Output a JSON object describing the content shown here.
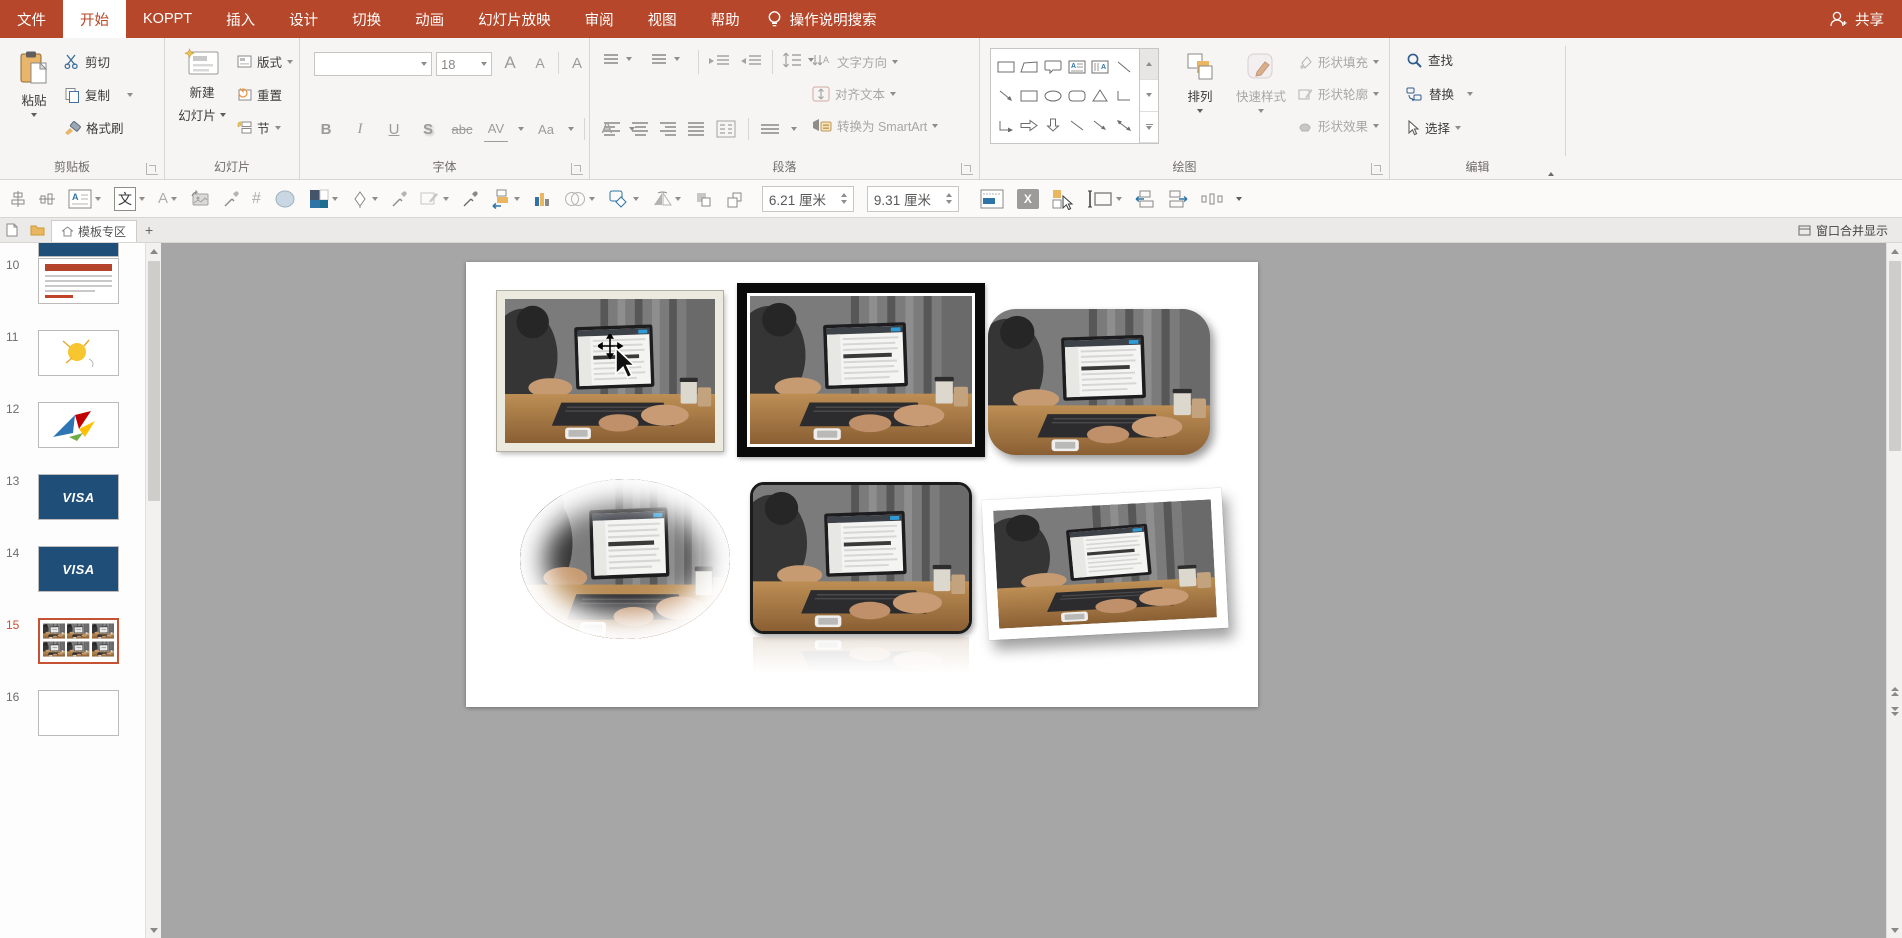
{
  "menubar": {
    "tabs": [
      {
        "label": "文件"
      },
      {
        "label": "开始"
      },
      {
        "label": "KOPPT"
      },
      {
        "label": "插入"
      },
      {
        "label": "设计"
      },
      {
        "label": "切换"
      },
      {
        "label": "动画"
      },
      {
        "label": "幻灯片放映"
      },
      {
        "label": "审阅"
      },
      {
        "label": "视图"
      },
      {
        "label": "帮助"
      }
    ],
    "search_label": "操作说明搜索",
    "share_label": "共享"
  },
  "ribbon": {
    "clipboard": {
      "group_label": "剪贴板",
      "paste": "粘贴",
      "cut": "剪切",
      "copy": "复制",
      "format_painter": "格式刷"
    },
    "slides": {
      "group_label": "幻灯片",
      "new_slide_line1": "新建",
      "new_slide_line2": "幻灯片",
      "layout": "版式",
      "reset": "重置",
      "section": "节"
    },
    "font": {
      "group_label": "字体",
      "font_size": "18",
      "bold": "B",
      "italic": "I",
      "underline": "U",
      "shadow": "S",
      "strikethrough": "abc",
      "char_spacing": "AV",
      "change_case": "Aa",
      "font_color": "A",
      "grow_font": "A",
      "shrink_font": "A",
      "clear_format": "A"
    },
    "paragraph": {
      "group_label": "段落",
      "text_direction": "文字方向",
      "align_text": "对齐文本",
      "smartart": "转换为 SmartArt"
    },
    "drawing": {
      "group_label": "绘图",
      "arrange": "排列",
      "quick_styles": "快速样式",
      "shape_fill": "形状填充",
      "shape_outline": "形状轮廓",
      "shape_effects": "形状效果"
    },
    "editing": {
      "group_label": "编辑",
      "find": "查找",
      "replace": "替换",
      "select": "选择"
    }
  },
  "drawing_toolbar": {
    "shape_width": "6.21 厘米",
    "shape_height": "9.31 厘米",
    "vertical_text_icon": "文",
    "wordart_icon": "A",
    "hash_icon": "#",
    "delete_icon": "X"
  },
  "tab_bar": {
    "template_tab": "模板专区",
    "add_tab": "+",
    "window_merge": "窗口合并显示"
  },
  "slide_panel": {
    "slides": [
      {
        "num": "10"
      },
      {
        "num": "11"
      },
      {
        "num": "12"
      },
      {
        "num": "13"
      },
      {
        "num": "14"
      },
      {
        "num": "15"
      },
      {
        "num": "16"
      }
    ],
    "selected_slide": "15",
    "visa_text": "VISA"
  },
  "colors": {
    "accent_red": "#B7472A",
    "selection_red": "#C75133",
    "canvas_gray": "#A6A6A6",
    "visa_navy": "#1F4E79"
  }
}
